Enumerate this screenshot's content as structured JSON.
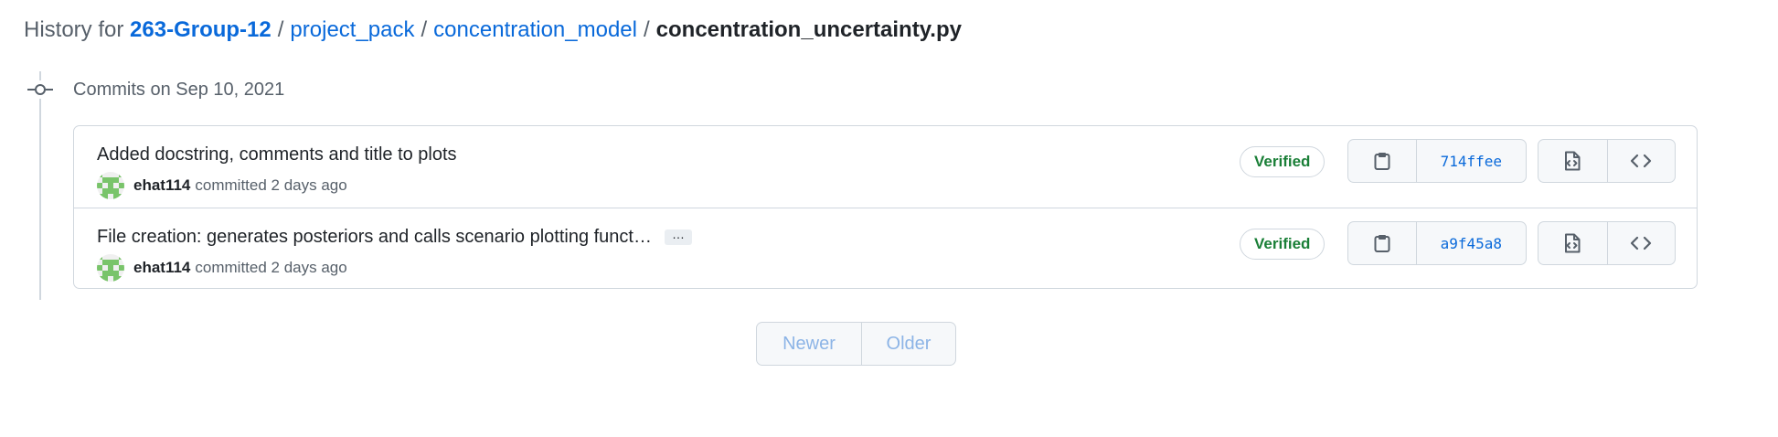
{
  "header": {
    "prefix": "History for",
    "repo": "263-Group-12",
    "path": [
      "project_pack",
      "concentration_model"
    ],
    "separator": "/",
    "file": "concentration_uncertainty.py"
  },
  "timeline": {
    "date_heading": "Commits on Sep 10, 2021",
    "icon": "git-commit-icon"
  },
  "commits": [
    {
      "title": "Added docstring, comments and title to plots",
      "author": "ehat114",
      "action": "committed",
      "time": "2 days ago",
      "badge": "Verified",
      "sha": "714ffee",
      "has_ellipsis": false
    },
    {
      "title": "File creation: generates posteriors and calls scenario plotting funct…",
      "ellipsis": "…",
      "author": "ehat114",
      "action": "committed",
      "time": "2 days ago",
      "badge": "Verified",
      "sha": "a9f45a8",
      "has_ellipsis": true
    }
  ],
  "icons": {
    "copy": "clipboard-icon",
    "browse_at": "file-code-icon",
    "browse_repo": "code-icon"
  },
  "pagination": {
    "newer": "Newer",
    "older": "Older"
  },
  "colors": {
    "link": "#0969da",
    "verified": "#1a7f37",
    "border": "#d0d7de",
    "muted": "#57606a",
    "disabled_link": "#8cb4e6"
  }
}
